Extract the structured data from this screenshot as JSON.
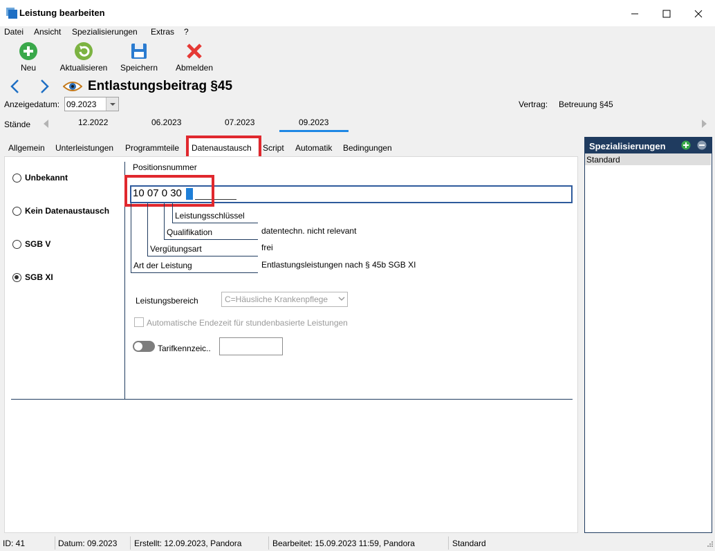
{
  "window": {
    "title": "Leistung bearbeiten"
  },
  "menu": [
    "Datei",
    "Ansicht",
    "Spezialisierungen",
    "Extras",
    "?"
  ],
  "toolbar": {
    "new": "Neu",
    "refresh": "Aktualisieren",
    "save": "Speichern",
    "logout": "Abmelden"
  },
  "header": {
    "title": "Entlastungsbeitrag §45"
  },
  "filters": {
    "display_date_label": "Anzeigedatum:",
    "display_date_value": "09.2023",
    "contract_label": "Vertrag:",
    "contract_value": "Betreuung §45"
  },
  "versions": {
    "label": "Stände",
    "items": [
      "12.2022",
      "06.2023",
      "07.2023",
      "09.2023"
    ],
    "selected": "09.2023"
  },
  "tabs": [
    "Allgemein",
    "Unterleistungen",
    "Programmteile",
    "Datenaustausch",
    "Script",
    "Automatik",
    "Bedingungen"
  ],
  "active_tab": "Datenaustausch",
  "exchange_options": [
    "Unbekannt",
    "Kein Datenaustausch",
    "SGB V",
    "SGB XI"
  ],
  "selected_option": "SGB XI",
  "position": {
    "label": "Positionsnummer",
    "value": "10 07 0 30",
    "fields": {
      "leistungsschluessel": {
        "label": "Leistungsschlüssel",
        "value": ""
      },
      "qualifikation": {
        "label": "Qualifikation",
        "value": "datentechn. nicht relevant"
      },
      "verguetungsart": {
        "label": "Vergütungsart",
        "value": "frei"
      },
      "art": {
        "label": "Art der Leistung",
        "value": "Entlastungsleistungen nach § 45b SGB XI"
      }
    }
  },
  "service_area": {
    "label": "Leistungsbereich",
    "value": "C=Häusliche Krankenpflege"
  },
  "auto_end_label": "Automatische Endezeit für stundenbasierte Leistungen",
  "tariff_label": "Tarifkennzeic..",
  "tariff_value": "",
  "specializations": {
    "title": "Spezialisierungen",
    "items": [
      "Standard"
    ]
  },
  "status": {
    "id": "ID: 41",
    "date": "Datum: 09.2023",
    "created": "Erstellt: 12.09.2023, Pandora",
    "edited": "Bearbeitet: 15.09.2023 11:59, Pandora",
    "spec": "Standard"
  },
  "colors": {
    "accent": "#1f3b5f",
    "highlight": "#e0282e",
    "input_border": "#2e5a9c"
  }
}
